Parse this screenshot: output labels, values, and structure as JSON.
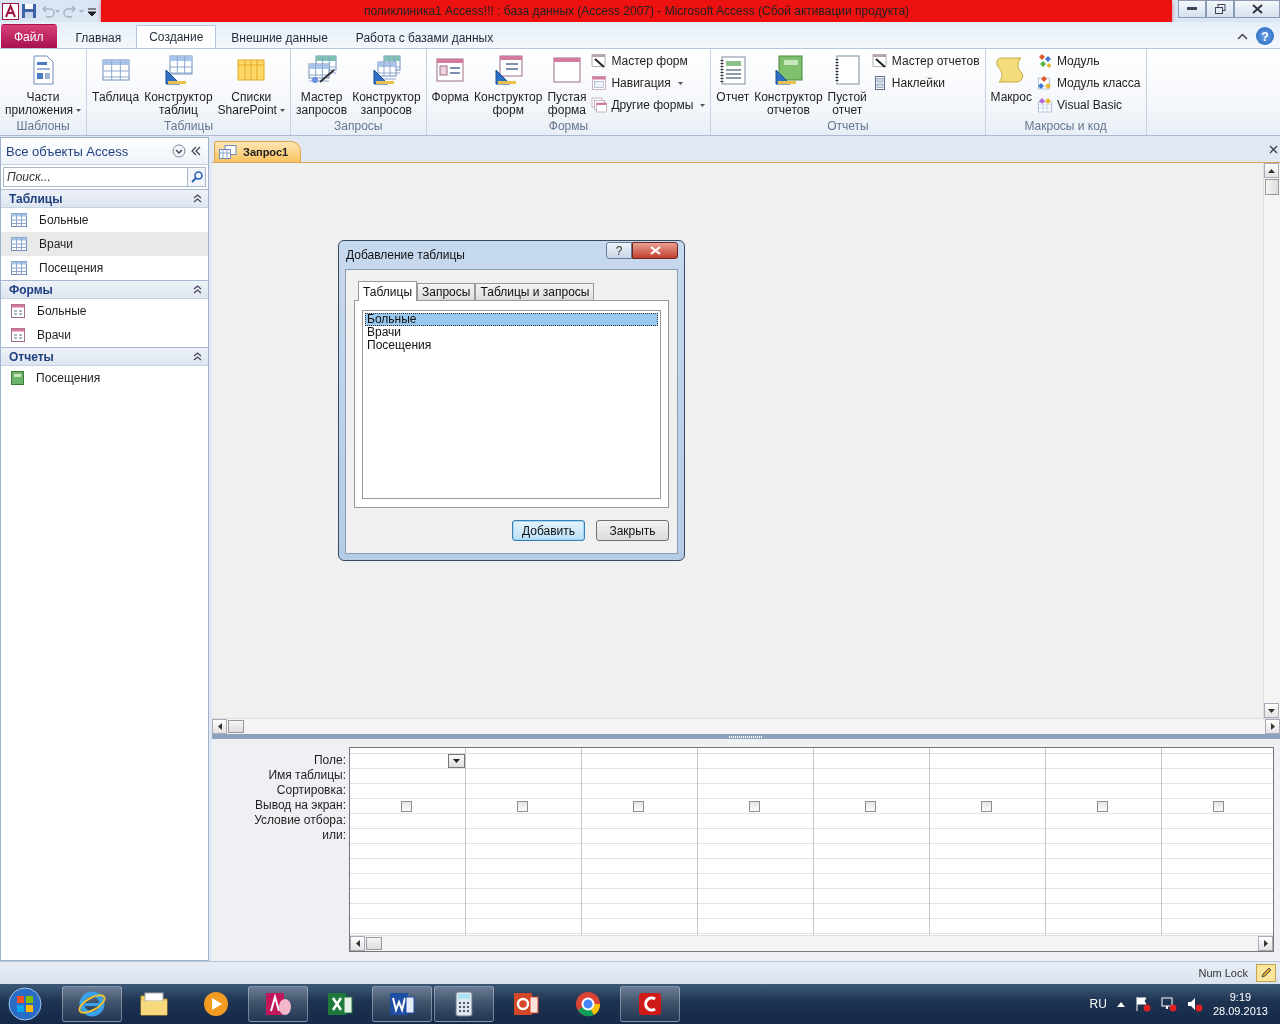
{
  "title_bar": {
    "title": "поликлиника1 Access!!! : база данных (Access 2007)  -  Microsoft Access (Сбой активации продукта)"
  },
  "tabs": [
    {
      "label": "Файл",
      "kind": "file",
      "selected": false
    },
    {
      "label": "Главная",
      "kind": "normal",
      "selected": false
    },
    {
      "label": "Создание",
      "kind": "normal",
      "selected": true
    },
    {
      "label": "Внешние данные",
      "kind": "normal",
      "selected": false
    },
    {
      "label": "Работа с базами данных",
      "kind": "normal",
      "selected": false
    }
  ],
  "ribbon_help": "?",
  "ribbon": {
    "groups": [
      {
        "label": "Шаблоны",
        "large_buttons": [
          {
            "label": "Части\nприложения",
            "kind": "parts",
            "dropdown": true
          }
        ]
      },
      {
        "label": "Таблицы",
        "large_buttons": [
          {
            "label": "Таблица",
            "kind": "table",
            "dropdown": false
          },
          {
            "label": "Конструктор\nтаблиц",
            "kind": "table-design",
            "dropdown": false
          },
          {
            "label": "Списки\nSharePoint",
            "kind": "list",
            "dropdown": true
          }
        ]
      },
      {
        "label": "Запросы",
        "large_buttons": [
          {
            "label": "Мастер\nзапросов",
            "kind": "query-wizard",
            "dropdown": false
          },
          {
            "label": "Конструктор\nзапросов",
            "kind": "query-design",
            "dropdown": false
          }
        ]
      },
      {
        "label": "Формы",
        "large_buttons": [
          {
            "label": "Форма",
            "kind": "form",
            "dropdown": false
          },
          {
            "label": "Конструктор\nформ",
            "kind": "form-design",
            "dropdown": false
          },
          {
            "label": "Пустая\nформа",
            "kind": "blank",
            "dropdown": false
          }
        ],
        "small_buttons": [
          {
            "label": "Мастер форм",
            "kind": "wizard",
            "dropdown": false
          },
          {
            "label": "Навигация",
            "kind": "nav",
            "dropdown": true
          },
          {
            "label": "Другие формы",
            "kind": "more-forms",
            "dropdown": true
          }
        ]
      },
      {
        "label": "Отчеты",
        "large_buttons": [
          {
            "label": "Отчет",
            "kind": "report",
            "dropdown": false
          },
          {
            "label": "Конструктор\nотчетов",
            "kind": "report-design",
            "dropdown": false
          },
          {
            "label": "Пустой\nотчет",
            "kind": "blank-report",
            "dropdown": false
          }
        ],
        "small_buttons": [
          {
            "label": "Мастер отчетов",
            "kind": "wizard",
            "dropdown": false
          },
          {
            "label": "Наклейки",
            "kind": "labels",
            "dropdown": false
          }
        ]
      },
      {
        "label": "Макросы и код",
        "large_buttons": [
          {
            "label": "Макрос",
            "kind": "macro",
            "dropdown": false
          }
        ],
        "small_buttons": [
          {
            "label": "Модуль",
            "kind": "module",
            "dropdown": false
          },
          {
            "label": "Модуль класса",
            "kind": "class-module",
            "dropdown": false
          },
          {
            "label": "Visual Basic",
            "kind": "vba",
            "dropdown": false
          }
        ]
      }
    ]
  },
  "nav": {
    "title": "Все объекты Access",
    "search": {
      "placeholder": "Поиск..."
    },
    "groups": [
      {
        "title": "Таблицы",
        "kind": "table",
        "expanded": true,
        "items": [
          {
            "label": "Больные",
            "selected": false
          },
          {
            "label": "Врачи",
            "selected": true
          },
          {
            "label": "Посещения",
            "selected": false
          }
        ]
      },
      {
        "title": "Формы",
        "kind": "form",
        "expanded": true,
        "items": [
          {
            "label": "Больные",
            "selected": false
          },
          {
            "label": "Врачи",
            "selected": false
          }
        ]
      },
      {
        "title": "Отчеты",
        "kind": "report",
        "expanded": true,
        "items": [
          {
            "label": "Посещения",
            "selected": false
          }
        ]
      }
    ]
  },
  "document_tab": {
    "label": "Запрос1"
  },
  "dialog": {
    "title": "Добавление таблицы",
    "help": "?",
    "tabs": [
      {
        "label": "Таблицы",
        "selected": true
      },
      {
        "label": "Запросы",
        "selected": false
      },
      {
        "label": "Таблицы и запросы",
        "selected": false
      }
    ],
    "items": [
      {
        "label": "Больные",
        "selected": true
      },
      {
        "label": "Врачи",
        "selected": false
      },
      {
        "label": "Посещения",
        "selected": false
      }
    ],
    "buttons": [
      {
        "label": "Добавить",
        "kind": "default"
      },
      {
        "label": "Закрыть",
        "kind": "normal"
      }
    ]
  },
  "grid": {
    "row_labels": [
      "Поле:",
      "Имя таблицы:",
      "Сортировка:",
      "Вывод на экран:",
      "Условие отбора:",
      "или:"
    ],
    "columns": [
      {
        "active": true,
        "show": false
      },
      {
        "active": false,
        "show": false
      },
      {
        "active": false,
        "show": false
      },
      {
        "active": false,
        "show": false
      },
      {
        "active": false,
        "show": false
      },
      {
        "active": false,
        "show": false
      },
      {
        "active": false,
        "show": false
      },
      {
        "active": false,
        "show": false
      }
    ]
  },
  "status_bar": {
    "indicator": "Num Lock"
  },
  "taskbar": {
    "apps": [
      {
        "kind": "ie",
        "running": true
      },
      {
        "kind": "explorer",
        "running": false
      },
      {
        "kind": "media",
        "running": false
      },
      {
        "kind": "access",
        "running": true
      },
      {
        "kind": "excel",
        "running": false
      },
      {
        "kind": "word",
        "running": true
      },
      {
        "kind": "calc",
        "running": true
      },
      {
        "kind": "powerpoint",
        "running": false
      },
      {
        "kind": "chrome",
        "running": false
      },
      {
        "kind": "red",
        "running": true
      }
    ],
    "language": "RU",
    "time": "9:19",
    "date": "28.09.2013"
  }
}
